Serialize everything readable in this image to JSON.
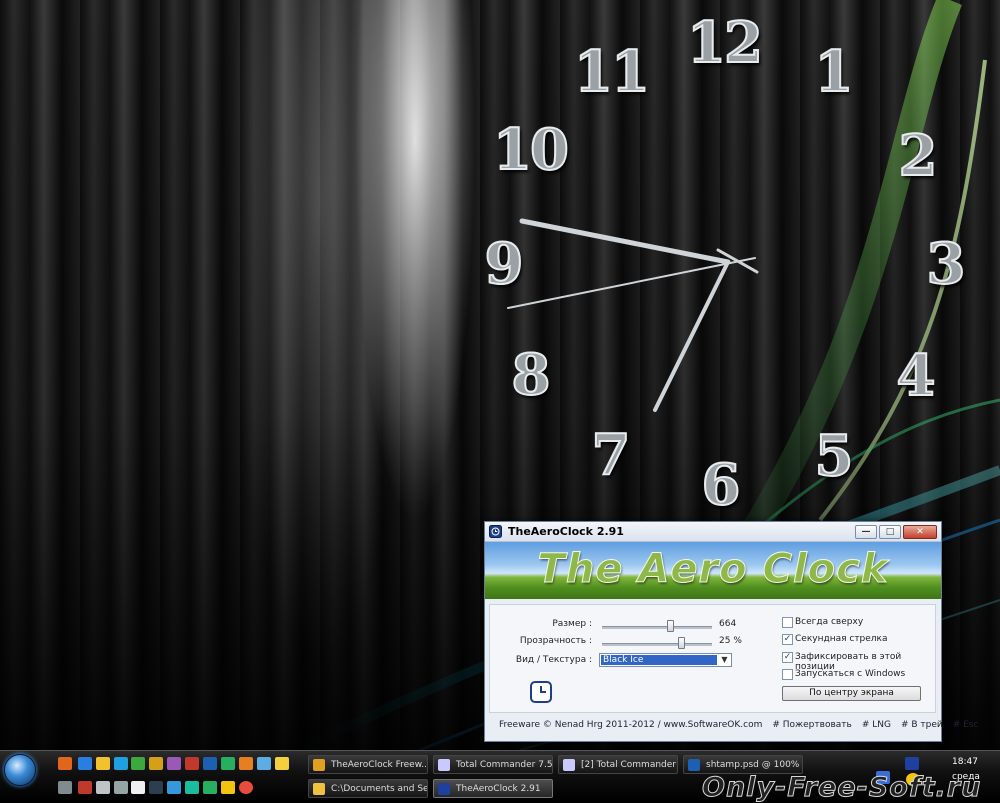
{
  "clock": {
    "numbers": [
      "12",
      "1",
      "2",
      "3",
      "4",
      "5",
      "6",
      "7",
      "8",
      "9",
      "10",
      "11"
    ]
  },
  "window": {
    "title": "TheAeroClock 2.91",
    "banner": "The Aero Clock",
    "size_label": "Размер :",
    "size_value": "664",
    "size_fraction": 0.62,
    "opacity_label": "Прозрачность :",
    "opacity_value": "25 %",
    "opacity_fraction": 0.72,
    "texture_label": "Вид / Текстура :",
    "texture_selected": "Black Ice",
    "checkboxes": [
      {
        "label": "Всегда сверху",
        "checked": false
      },
      {
        "label": "Секундная стрелка",
        "checked": true
      },
      {
        "label": "Зафиксировать в этой позиции",
        "checked": true
      },
      {
        "label": "Запускаться с Windows",
        "checked": false
      }
    ],
    "center_button": "По центру экрана",
    "footer_credit": "Freeware © Nenad Hrg 2011-2012 / www.SoftwareOK.com",
    "footer_links": [
      "# Пожертвовать",
      "# LNG",
      "# В трей",
      "# Esc"
    ]
  },
  "taskbar": {
    "tasks": [
      {
        "label": "TheAeroClock Freew...",
        "color": "#e0a020"
      },
      {
        "label": "Total Commander 7.5...",
        "color": "#c9c9ff"
      },
      {
        "label": "[2] Total Commander ...",
        "color": "#c9c9ff"
      },
      {
        "label": "shtamp.psd @ 100% ...",
        "color": "#1d5fb0"
      },
      {
        "label": "C:\\Documents and Se...",
        "color": "#f0c040"
      },
      {
        "label": "TheAeroClock 2.91",
        "color": "#2040a0"
      }
    ],
    "time": "18:47",
    "day": "среда",
    "colors": {
      "accent": "#3166c6"
    }
  },
  "watermark": "Only-Free-Soft.ru"
}
